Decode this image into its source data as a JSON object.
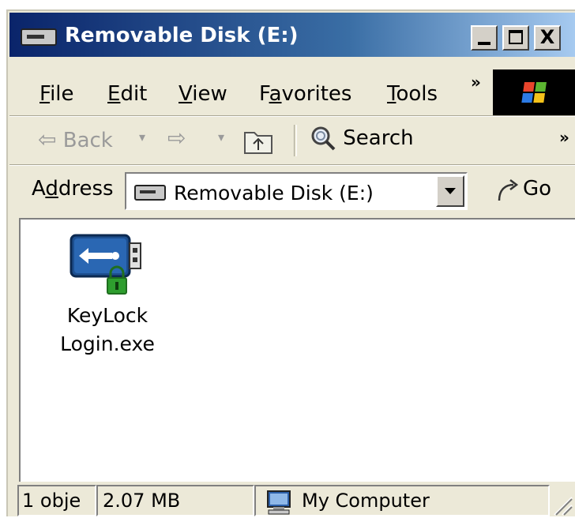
{
  "window": {
    "title": "Removable Disk (E:)",
    "title_icon": "removable-drive-icon",
    "controls": [
      "minimize",
      "maximize",
      "close"
    ],
    "close_glyph": "X"
  },
  "menu": {
    "items": [
      {
        "label_pre": "",
        "mnemonic": "F",
        "label_post": "ile"
      },
      {
        "label_pre": "",
        "mnemonic": "E",
        "label_post": "dit"
      },
      {
        "label_pre": "",
        "mnemonic": "V",
        "label_post": "iew"
      },
      {
        "label_pre": "F",
        "mnemonic": "a",
        "label_post": "vorites"
      },
      {
        "label_pre": "",
        "mnemonic": "T",
        "label_post": "ools"
      }
    ],
    "overflow": "»"
  },
  "toolbar": {
    "back_label": "Back",
    "search_label": "Search",
    "overflow": "»"
  },
  "address": {
    "label_pre": "A",
    "mnemonic": "d",
    "label_post": "dress",
    "value": "Removable Disk (E:)",
    "go_label": "Go"
  },
  "files": [
    {
      "name_line1": "KeyLock",
      "name_line2": "Login.exe",
      "icon": "usb-lock-icon"
    }
  ],
  "status": {
    "objects": "1 obje",
    "size": "2.07 MB",
    "zone": "My Computer"
  },
  "colors": {
    "title_start": "#0a246a",
    "title_end": "#a6caf0",
    "face": "#ece9d8",
    "lock_green": "#2e9e2e"
  }
}
